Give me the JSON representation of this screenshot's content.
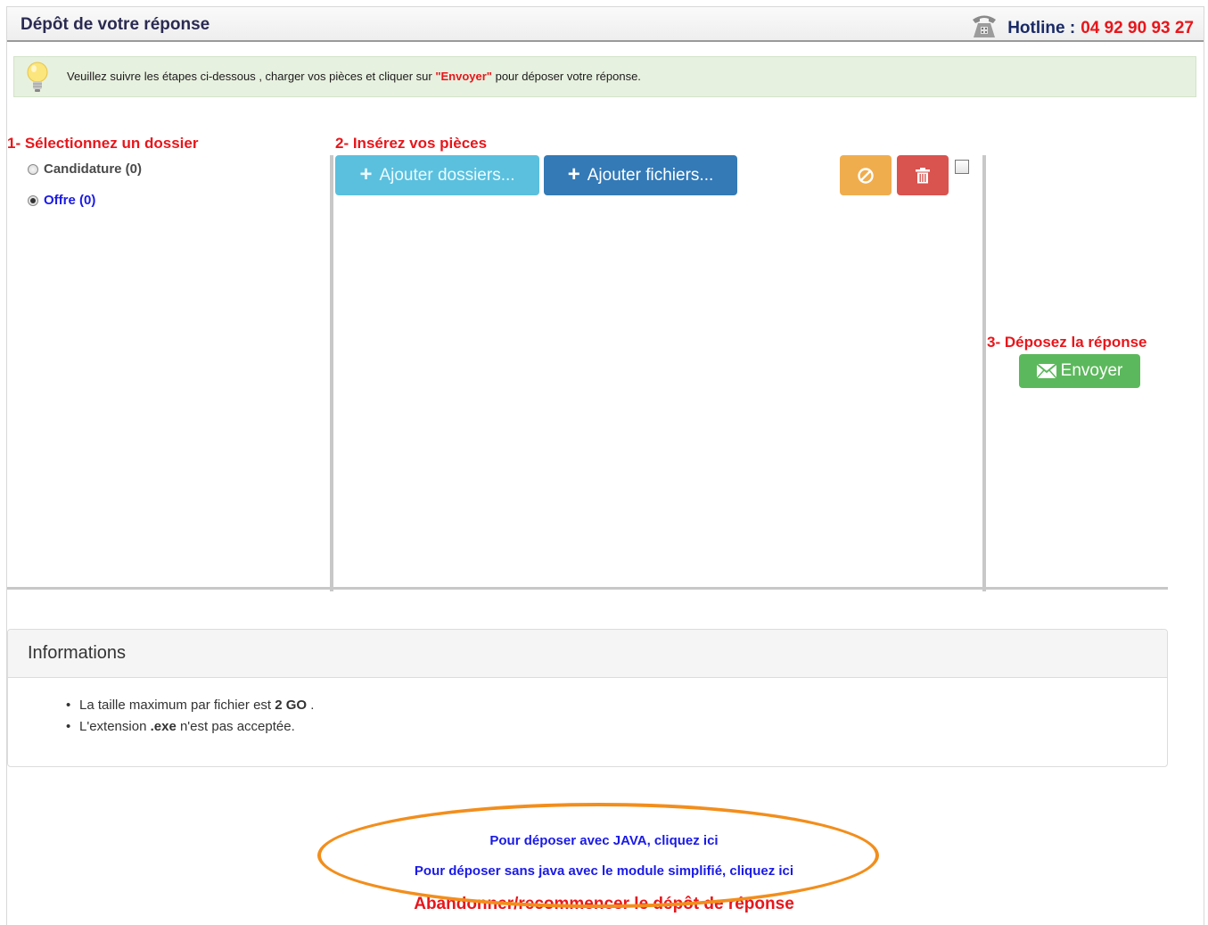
{
  "header": {
    "title": "Dépôt de votre réponse",
    "hotline_label": "Hotline :",
    "hotline_number": "04 92 90 93 27",
    "phone_icon": "phone-icon"
  },
  "notice": {
    "icon": "lightbulb-icon",
    "text_before": "Veuillez suivre les étapes ci-dessous , charger vos pièces et cliquer sur",
    "highlight": "\"Envoyer\"",
    "text_after": "pour déposer votre réponse."
  },
  "steps": {
    "step1": "1- Sélectionnez un dossier",
    "step2": "2- Insérez vos pièces",
    "step3": "3- Déposez la réponse"
  },
  "folders": [
    {
      "label": "Candidature (0)",
      "checked": false,
      "color": "#4a4a4a"
    },
    {
      "label": "Offre (0)",
      "checked": true,
      "color": "#1a1ae6"
    }
  ],
  "toolbar": {
    "add_folders_label": "Ajouter dossiers...",
    "add_files_label": "Ajouter fichiers...",
    "cancel_icon": "cancel-icon",
    "delete_icon": "trash-icon",
    "send_label": "Envoyer",
    "send_icon": "envelope-icon"
  },
  "info": {
    "title": "Informations",
    "items": [
      {
        "before": "La taille maximum par fichier est",
        "bold": "2 GO",
        "after": "."
      },
      {
        "before": "L'extension",
        "bold": ".exe",
        "after": "n'est pas acceptée."
      }
    ]
  },
  "links": {
    "java": "Pour déposer avec JAVA, cliquez ici",
    "simple": "Pour déposer sans java avec le module simplifié, cliquez ici",
    "abandon": "Abandonner/recommencer le dépôt de réponse"
  },
  "colors": {
    "accent_red": "#e8161b",
    "link_blue": "#1a1ae6",
    "highlight_orange": "#f28e1c"
  }
}
